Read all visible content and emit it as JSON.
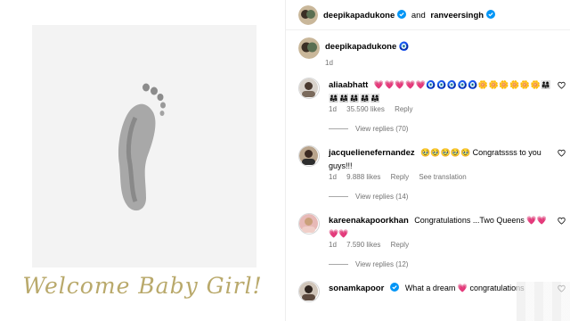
{
  "post": {
    "image_text": "Welcome Baby Girl!",
    "author": "deepikapadukone",
    "coauthor_connector": "and",
    "coauthor": "ranveersingh"
  },
  "caption": {
    "username": "deepikapadukone",
    "emoji": "🧿",
    "time": "1d"
  },
  "comments": [
    {
      "username": "aliaabhatt",
      "text": "💗💗💗💗💗🧿🧿🧿🧿🧿🌼🌼🌼🌼🌼🌼👨‍👩‍👧👨‍👩‍👧👨‍👩‍👧👨‍👩‍👧👨‍👩‍👧👨‍👩‍👧",
      "time": "1d",
      "likes": "35.590 likes",
      "reply": "Reply",
      "translation": "",
      "view_replies": "View replies (70)"
    },
    {
      "username": "jacquelienefernandez",
      "text": "🥹🥹🥹🥹🥹 Congratssss to you guys!!!",
      "time": "1d",
      "likes": "9.888 likes",
      "reply": "Reply",
      "translation": "See translation",
      "view_replies": "View replies (14)"
    },
    {
      "username": "kareenakapoorkhan",
      "text": "Congratulations ...Two Queens 💗💗💗💗",
      "time": "1d",
      "likes": "7.590 likes",
      "reply": "Reply",
      "translation": "",
      "view_replies": "View replies (12)"
    },
    {
      "username": "sonamkapoor",
      "text": "What a dream 💗 congratulations",
      "time": "",
      "likes": "",
      "reply": "",
      "translation": "",
      "view_replies": ""
    }
  ],
  "colors": {
    "verified": "#0095f6",
    "heart": "#262626",
    "meta": "#737373",
    "script_gold": "#b9a96b"
  }
}
